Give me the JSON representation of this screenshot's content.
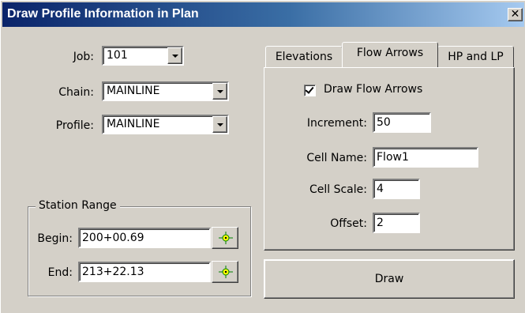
{
  "window": {
    "title": "Draw Profile Information in Plan",
    "close_label": "✕"
  },
  "left": {
    "job": {
      "label": "Job:",
      "value": "101"
    },
    "chain": {
      "label": "Chain:",
      "value": "MAINLINE"
    },
    "profile": {
      "label": "Profile:",
      "value": "MAINLINE"
    }
  },
  "station_range": {
    "title": "Station Range",
    "begin": {
      "label": "Begin:",
      "value": "200+00.69"
    },
    "end": {
      "label": "End:",
      "value": "213+22.13"
    },
    "pick_icon": "target-crosshair-icon"
  },
  "tabs": [
    {
      "label": "Elevations",
      "active": false
    },
    {
      "label": "Flow Arrows",
      "active": true
    },
    {
      "label": "HP and LP",
      "active": false
    }
  ],
  "flow_arrows": {
    "draw_flow_arrows": {
      "label": "Draw Flow Arrows",
      "checked": true
    },
    "increment": {
      "label": "Increment:",
      "value": "50"
    },
    "cell_name": {
      "label": "Cell Name:",
      "value": "Flow1"
    },
    "cell_scale": {
      "label": "Cell Scale:",
      "value": "4"
    },
    "offset": {
      "label": "Offset:",
      "value": "2"
    }
  },
  "actions": {
    "draw_label": "Draw"
  },
  "colors": {
    "title_start": "#0a246a",
    "title_end": "#a6caf0",
    "face": "#d4d0c8"
  }
}
